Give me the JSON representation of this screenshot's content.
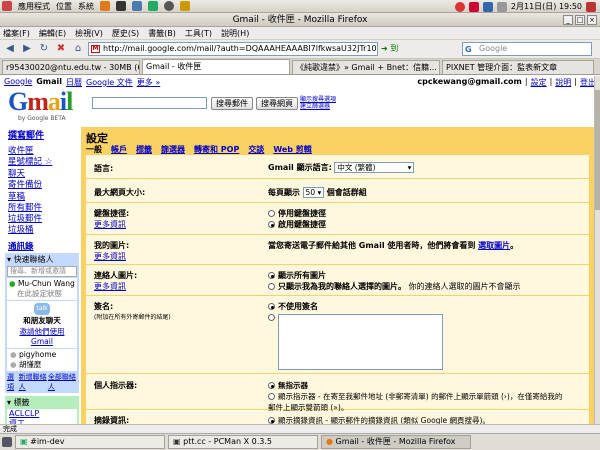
{
  "panel": {
    "menus": [
      "應用程式",
      "位置",
      "系統"
    ],
    "clock": "2月11日(日) 19:50"
  },
  "window": {
    "title": "Gmail - 收件匣 - Mozilla Firefox"
  },
  "menubar": [
    "檔案(F)",
    "編輯(E)",
    "檢視(V)",
    "歷史(S)",
    "書籤(B)",
    "工具(T)",
    "說明(H)"
  ],
  "navbar": {
    "url": "http://mail.google.com/mail/?auth=DQAAAHEAAABI7lfkwsaU32JTr10bnTMzPOWwI",
    "go_label": "到",
    "search_placeholder": "Google"
  },
  "tabs": [
    "r95430020@ntu.edu.tw - 30MB (60%) -",
    "Gmail - 收件匣",
    "《純歌違禁》» Gmail + Bnet：信籍...",
    "PIXNET 管理介面：監表新文章"
  ],
  "gmail": {
    "toplinks": [
      "Google",
      "Gmail",
      "日曆",
      "Google 文件",
      "更多 »"
    ],
    "user": {
      "email": "cpckewang@gmail.com",
      "settings": "設定",
      "help": "說明",
      "logout": "登出"
    },
    "logo_sub": "by Google  BETA",
    "search_mail_btn": "搜尋郵件",
    "search_web_btn": "搜尋網頁",
    "search_opts": [
      "顯示搜尋選項",
      "建立篩選器"
    ]
  },
  "sidebar": {
    "compose": "撰寫郵件",
    "nav": [
      "收件匣",
      "星號標記 ☆",
      "聊天",
      "寄件備份",
      "草稿",
      "所有郵件",
      "垃圾郵件",
      "垃圾桶"
    ],
    "contacts": "通訊錄",
    "quick_contacts": "快速聯絡人",
    "contact_search_placeholder": "搜尋、新增或邀請",
    "me": "Mu-Chun Wang",
    "me_status": "在此設定狀態",
    "talk_promo": "和朋友聊天",
    "talk_invite": "邀請他們使用",
    "talk_gmail": "Gmail",
    "contacts_list": [
      "pigyhome",
      "胡懂麼"
    ],
    "options": "選項",
    "add_contact": "新增聯絡人",
    "all_contacts": "全部聯絡人",
    "labels_title": "標籤",
    "labels": [
      "ACLCLP",
      "資工"
    ]
  },
  "settings": {
    "title": "設定",
    "tabs": [
      "一般",
      "帳戶",
      "標籤",
      "篩選器",
      "轉寄和 POP",
      "交談",
      "Web 剪輯"
    ],
    "language": {
      "label": "語言:",
      "prefix": "Gmail 顯示語言:",
      "value": "中文 (繁體)"
    },
    "pagesize": {
      "label": "最大網頁大小:",
      "prefix": "每頁顯示",
      "value": "50",
      "suffix": "個會話群組"
    },
    "shortcuts": {
      "label": "鍵盤捷徑:",
      "more": "更多資訊",
      "opt1": "停用鍵盤捷徑",
      "opt2": "啟用鍵盤捷徑",
      "selected": 2
    },
    "mypicture": {
      "label": "我的圖片:",
      "more": "更多資訊",
      "text": "當您寄送電子郵件給其他 Gmail 使用者時，他們將會看到",
      "link": "選取圖片",
      "end": "。"
    },
    "contactpics": {
      "label": "連絡人圖片:",
      "more": "更多資訊",
      "opt1": "顯示所有圖片",
      "opt2": "只顯示我為我的聯絡人選擇的圖片。",
      "opt2_note": "你的連絡人選取的圖片不會顯示"
    },
    "signature": {
      "label": "簽名:",
      "note": "(附加在所有外寄郵件的結尾)",
      "opt1": "不使用簽名"
    },
    "personal": {
      "label": "個人指示器:",
      "opt1": "無指示器",
      "opt2": "顯示指示器 - 在寄至我郵件地址 (非郵寄清單) 的郵件上顯示單箭頭 (›)，在僅寄給我的郵件上顯示雙箭頭 (»)。"
    },
    "snippets": {
      "label": "摘錄資訊:",
      "opt1": "顯示摘錄資訊 - 顯示郵件的摘錄資訊 (類似 Google 網頁搜尋)。"
    }
  },
  "status": "完成",
  "taskbar": [
    "#im-dev",
    "ptt.cc - PCMan X 0.3.5",
    "Gmail - 收件匣 - Mozilla Firefox"
  ],
  "colors": {
    "settings_bg": "#fad163",
    "settings_inner": "#fff8de",
    "contacts_bg": "#c3d9ff"
  }
}
